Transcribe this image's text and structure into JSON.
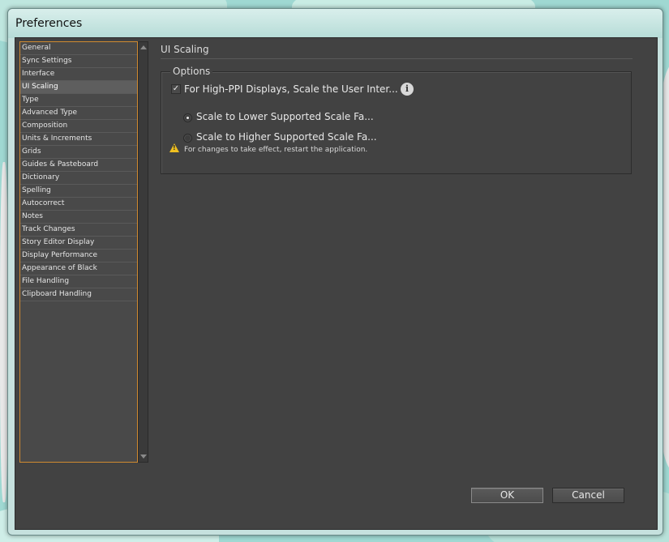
{
  "window": {
    "title": "Preferences"
  },
  "sidebar": {
    "items": [
      "General",
      "Sync Settings",
      "Interface",
      "UI Scaling",
      "Type",
      "Advanced Type",
      "Composition",
      "Units & Increments",
      "Grids",
      "Guides & Pasteboard",
      "Dictionary",
      "Spelling",
      "Autocorrect",
      "Notes",
      "Track Changes",
      "Story Editor Display",
      "Display Performance",
      "Appearance of Black",
      "File Handling",
      "Clipboard Handling"
    ],
    "selected_index": 3
  },
  "panel": {
    "title": "UI Scaling",
    "group_label": "Options",
    "checkbox": {
      "label": "For High-PPI Displays, Scale the User Inter...",
      "checked": true
    },
    "radios": [
      {
        "label": "Scale to Lower Supported Scale Fa...",
        "checked": true
      },
      {
        "label": "Scale to Higher Supported Scale Fa...",
        "checked": false
      }
    ],
    "warning": "For changes to take effect, restart the application.",
    "info_icon": "info-icon",
    "warning_icon": "warning-icon"
  },
  "buttons": {
    "ok": "OK",
    "cancel": "Cancel"
  },
  "colors": {
    "panel_bg": "#424242",
    "list_border": "#d08a30",
    "warning": "#f0c020"
  }
}
